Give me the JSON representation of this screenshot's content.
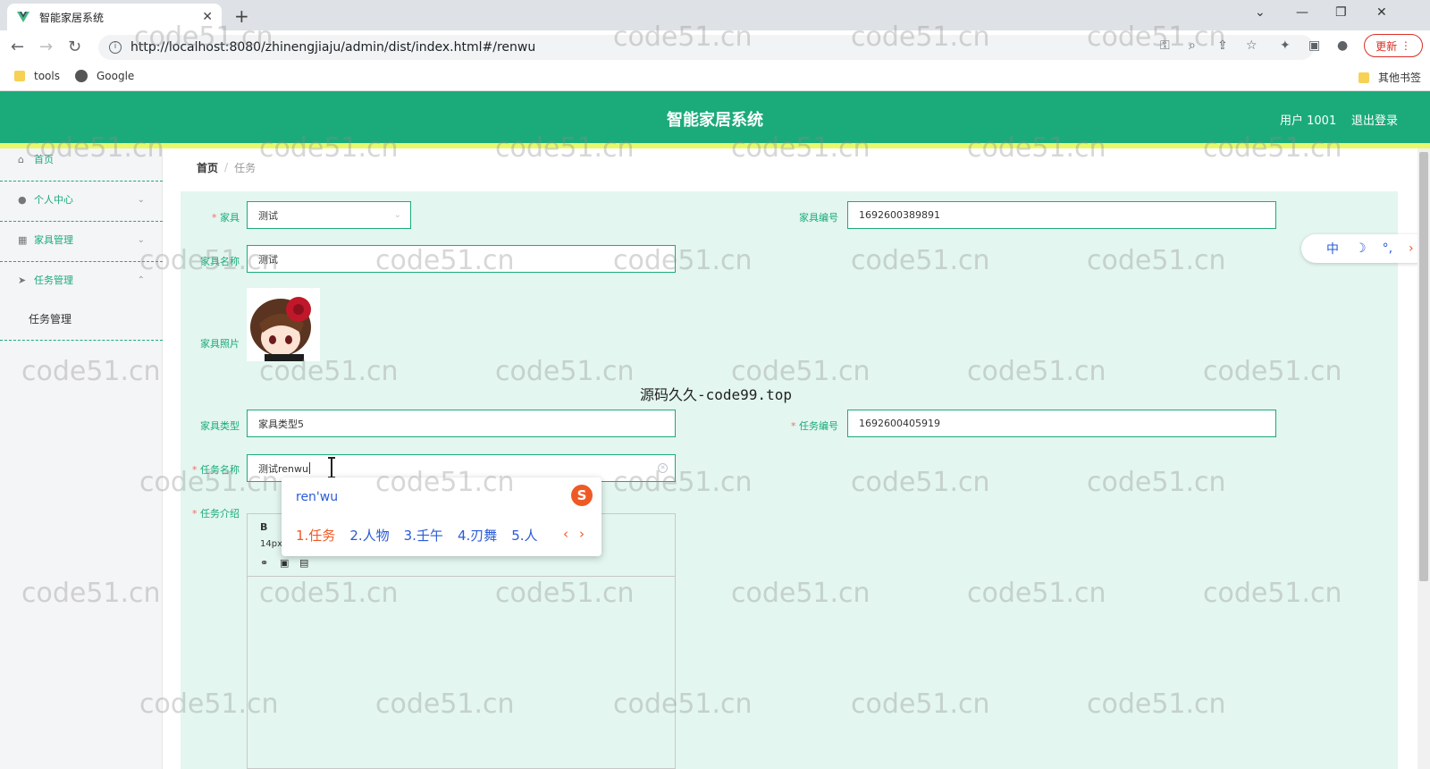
{
  "browser": {
    "tab_title": "智能家居系统",
    "url": "http://localhost:8080/zhinengjiaju/admin/dist/index.html#/renwu",
    "update_label": "更新",
    "bookmarks": [
      "tools",
      "Google"
    ],
    "other_bookmarks": "其他书签"
  },
  "header": {
    "title": "智能家居系统",
    "user": "用户 1001",
    "logout": "退出登录"
  },
  "sidebar": {
    "items": [
      {
        "label": "首页",
        "icon": "home-icon"
      },
      {
        "label": "个人中心",
        "icon": "user-icon"
      },
      {
        "label": "家具管理",
        "icon": "grid-icon"
      },
      {
        "label": "任务管理",
        "icon": "send-icon"
      }
    ],
    "submenu": "任务管理"
  },
  "breadcrumb": {
    "home": "首页",
    "sep": "/",
    "current": "任务"
  },
  "form": {
    "furniture_label": "家具",
    "furniture_value": "测试",
    "furniture_no_label": "家具编号",
    "furniture_no_value": "1692600389891",
    "furniture_name_label": "家具名称",
    "furniture_name_value": "测试",
    "photo_label": "家具照片",
    "type_label": "家具类型",
    "type_value": "家具类型5",
    "task_no_label": "任务编号",
    "task_no_value": "1692600405919",
    "task_name_label": "任务名称",
    "task_name_value": "测试renwu",
    "task_intro_label": "任务介绍",
    "required_mark": "*"
  },
  "editor": {
    "bold": "B",
    "size": "14px"
  },
  "ime": {
    "input": "ren'wu",
    "candidates": [
      "1.任务",
      "2.人物",
      "3.壬午",
      "4.刃舞",
      "5.人"
    ],
    "logo": "S"
  },
  "lang_pill": {
    "zh": "中",
    "moon": "☽",
    "punct": "°,",
    "arrow": "›"
  },
  "overlay_text": "源码久久-code99.top",
  "watermark": "code51.cn"
}
